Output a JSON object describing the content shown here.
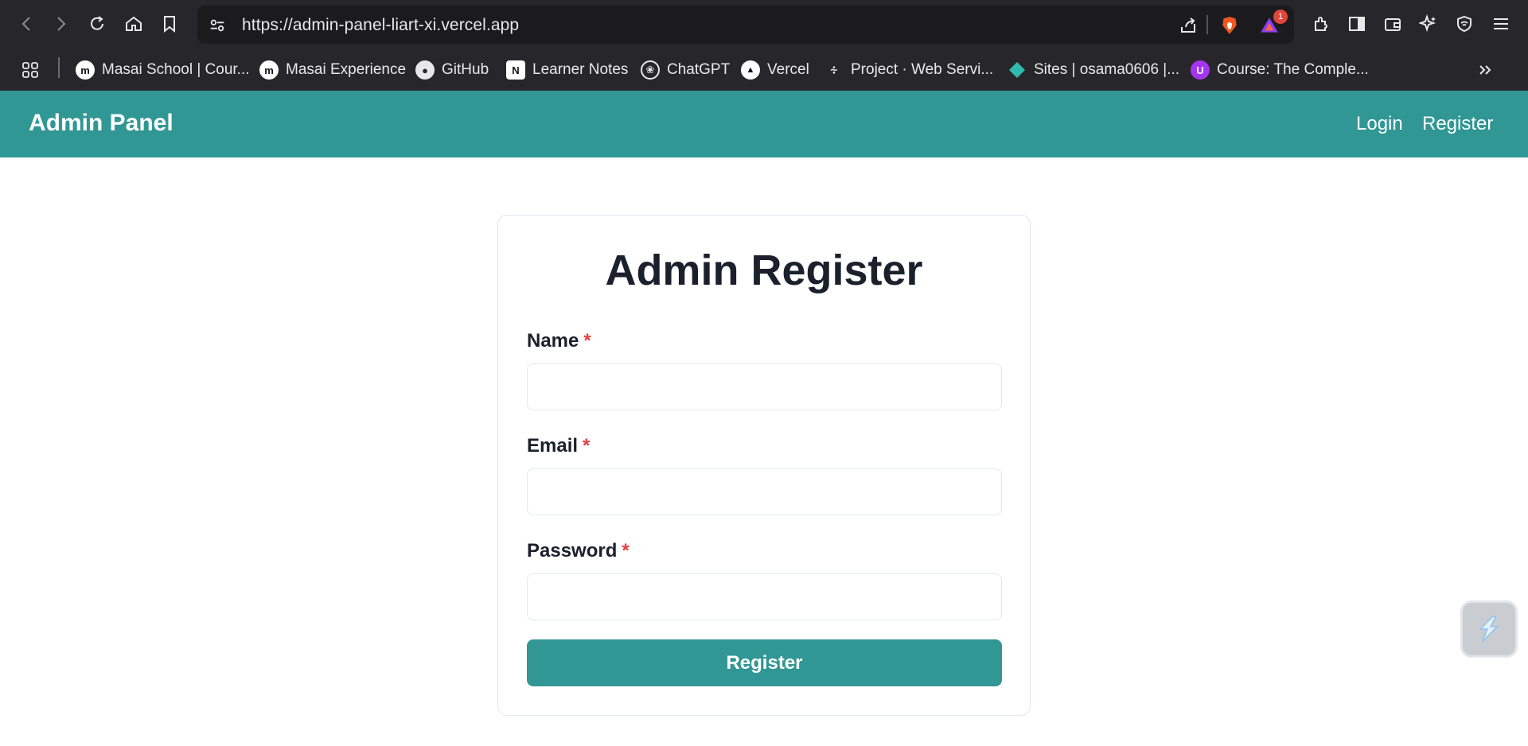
{
  "browser": {
    "url": "https://admin-panel-liart-xi.vercel.app",
    "notification_count": "1",
    "bookmarks": [
      {
        "label": "Masai School | Cour...",
        "icon": "masai-icon"
      },
      {
        "label": "Masai Experience",
        "icon": "masai-icon"
      },
      {
        "label": "GitHub",
        "icon": "github-icon"
      },
      {
        "label": "Learner Notes",
        "icon": "notion-icon"
      },
      {
        "label": "ChatGPT",
        "icon": "chatgpt-icon"
      },
      {
        "label": "Vercel",
        "icon": "vercel-icon"
      },
      {
        "label": "Project · Web Servi...",
        "icon": "render-icon"
      },
      {
        "label": "Sites | osama0606 |...",
        "icon": "netlify-icon"
      },
      {
        "label": "Course: The Comple...",
        "icon": "udemy-icon"
      }
    ]
  },
  "navbar": {
    "brand": "Admin Panel",
    "links": [
      "Login",
      "Register"
    ]
  },
  "form": {
    "title": "Admin Register",
    "fields": [
      {
        "label": "Name",
        "required": "*",
        "value": ""
      },
      {
        "label": "Email",
        "required": "*",
        "value": ""
      },
      {
        "label": "Password",
        "required": "*",
        "value": ""
      }
    ],
    "submit_label": "Register"
  },
  "colors": {
    "accent": "#319795",
    "required": "#e53e3e",
    "text": "#1a202c"
  }
}
